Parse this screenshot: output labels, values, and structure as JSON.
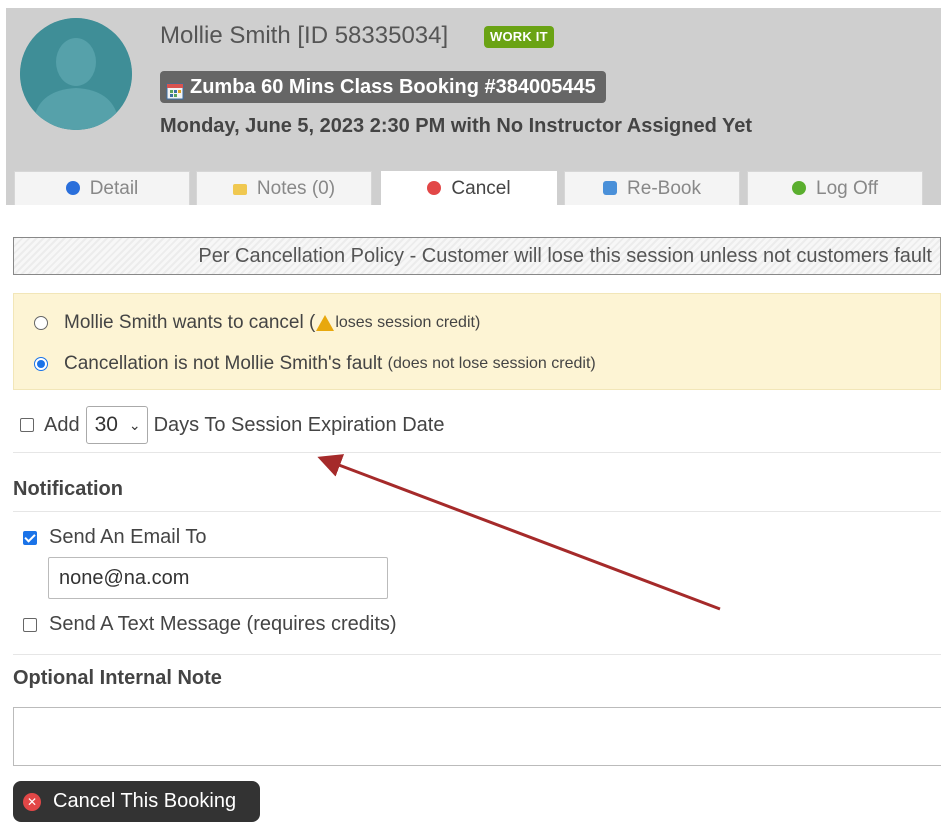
{
  "header": {
    "customer_name": "Mollie Smith [ID 58335034]",
    "badge": "WORK IT",
    "booking_title": "Zumba 60 Mins Class Booking #384005445",
    "datetime": "Monday, June 5, 2023 2:30 PM with No Instructor Assigned Yet"
  },
  "tabs": [
    {
      "label": "Detail",
      "icon": "info-icon"
    },
    {
      "label": "Notes (0)",
      "icon": "note-icon"
    },
    {
      "label": "Cancel",
      "icon": "cancel-icon",
      "active": true
    },
    {
      "label": "Re-Book",
      "icon": "rebook-icon"
    },
    {
      "label": "Log Off",
      "icon": "check-icon"
    }
  ],
  "policy": "Per Cancellation Policy - Customer will lose this session unless not customers fault",
  "cancel_options": {
    "wants_cancel": {
      "label": "Mollie Smith wants to cancel (",
      "note": "loses session credit)",
      "selected": false
    },
    "not_fault": {
      "label": "Cancellation is not Mollie Smith's fault",
      "note": "(does not lose session credit)",
      "selected": true
    }
  },
  "extension": {
    "add_label": "Add",
    "days_value": "30",
    "suffix": "Days To Session Expiration Date",
    "checked": false
  },
  "notification": {
    "title": "Notification",
    "email_label": "Send An Email To",
    "email_checked": true,
    "email_value": "none@na.com",
    "text_label": "Send A Text Message (requires credits)",
    "text_checked": false
  },
  "internal_note": {
    "title": "Optional Internal Note",
    "value": ""
  },
  "submit": {
    "label": "Cancel This Booking"
  },
  "colors": {
    "header_bg": "#cfcfcf",
    "badge_bg": "#6aa314",
    "policy_highlight": "#fdf4d4",
    "accent": "#1a73e8",
    "annotation_arrow": "#a52a2a"
  }
}
